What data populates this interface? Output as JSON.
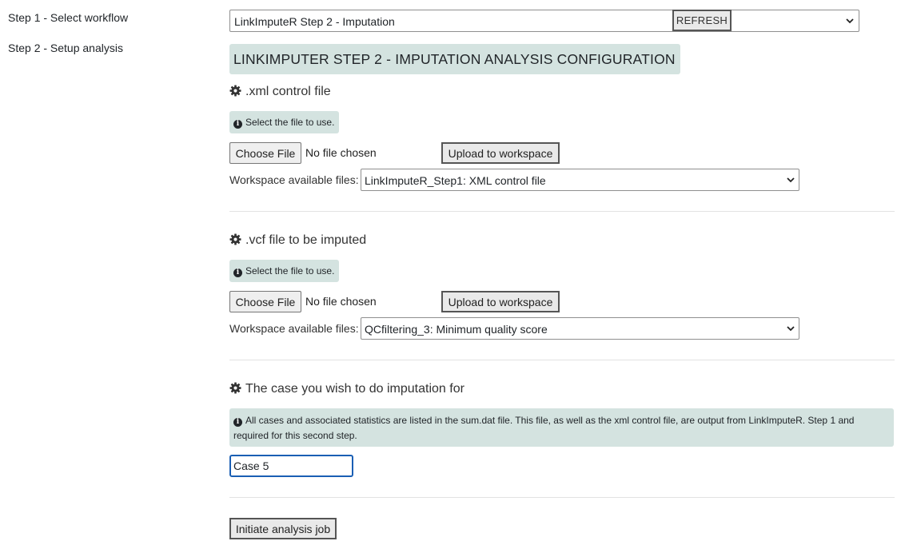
{
  "sidebar": {
    "items": [
      {
        "label": "Step 1 - Select workflow"
      },
      {
        "label": "Step 2 - Setup analysis"
      }
    ]
  },
  "workflow": {
    "selected": "LinkImputeR Step 2 - Imputation",
    "refresh_label": "REFRESH"
  },
  "config": {
    "title": "LINKIMPUTER STEP 2 - IMPUTATION ANALYSIS CONFIGURATION"
  },
  "sections": [
    {
      "heading": ".xml control file",
      "info": "Select the file to use.",
      "choose_label": "Choose File",
      "no_file_text": "No file chosen",
      "upload_label": "Upload to workspace",
      "ws_label": "Workspace available files:",
      "ws_selected": "LinkImputeR_Step1: XML control file"
    },
    {
      "heading": ".vcf file to be imputed",
      "info": "Select the file to use.",
      "choose_label": "Choose File",
      "no_file_text": "No file chosen",
      "upload_label": "Upload to workspace",
      "ws_label": "Workspace available files:",
      "ws_selected": "QCfiltering_3: Minimum quality score"
    },
    {
      "heading": "The case you wish to do imputation for",
      "info": "All cases and associated statistics are listed in the sum.dat file. This file, as well as the xml control file, are output from LinkImputeR. Step 1 and required for this second step.",
      "input_value": "Case 5"
    }
  ],
  "actions": {
    "initiate_label": "Initiate analysis job"
  },
  "icons": {
    "gear": "gear-icon",
    "info": "info-circle-icon",
    "chevron": "chevron-down-icon"
  },
  "colors": {
    "highlight_bg": "#d4e3e0",
    "focus_border": "#1a5fb4"
  }
}
